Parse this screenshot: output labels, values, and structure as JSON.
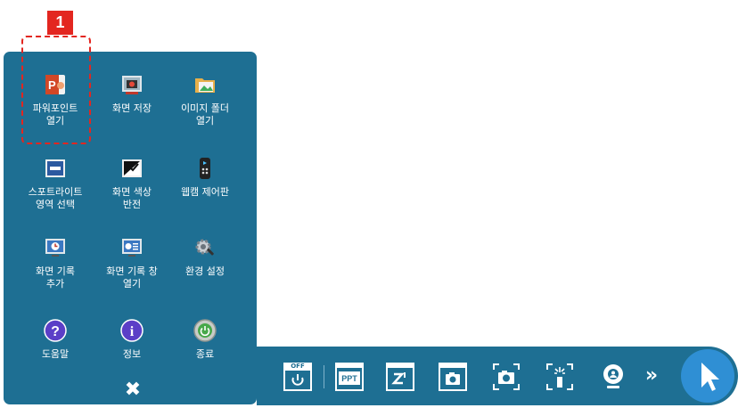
{
  "callout": {
    "number": "1"
  },
  "menu": {
    "items": [
      {
        "label": "파워포인트\n열기",
        "icon": "powerpoint-icon"
      },
      {
        "label": "화면 저장",
        "icon": "screen-save-icon"
      },
      {
        "label": "이미지 폴더\n열기",
        "icon": "image-folder-icon"
      },
      {
        "label": "스포트라이트\n영역 선택",
        "icon": "spotlight-icon"
      },
      {
        "label": "화면 색상\n반전",
        "icon": "invert-colors-icon"
      },
      {
        "label": "웹캠 제어판",
        "icon": "webcam-remote-icon"
      },
      {
        "label": "화면 기록\n추가",
        "icon": "add-screen-record-icon"
      },
      {
        "label": "화면 기록 창\n열기",
        "icon": "screen-record-window-icon"
      },
      {
        "label": "환경 설정",
        "icon": "settings-gear-icon"
      },
      {
        "label": "도움말",
        "icon": "help-icon"
      },
      {
        "label": "정보",
        "icon": "info-icon"
      },
      {
        "label": "종료",
        "icon": "power-icon"
      }
    ],
    "close_glyph": "✖"
  },
  "toolbar": {
    "off_label": "OFF",
    "ppt_label": "PPT",
    "chevron": "»",
    "buttons": [
      "power-off-icon",
      "ppt-icon",
      "draw-icon",
      "capture-window-icon",
      "camera-capture-icon",
      "spotlight-capture-icon",
      "webcam-icon",
      "expand-chevron-icon",
      "cursor-icon"
    ]
  },
  "colors": {
    "panel": "#1e6f93",
    "accent": "#2f8fd4",
    "callout": "#e32620"
  }
}
